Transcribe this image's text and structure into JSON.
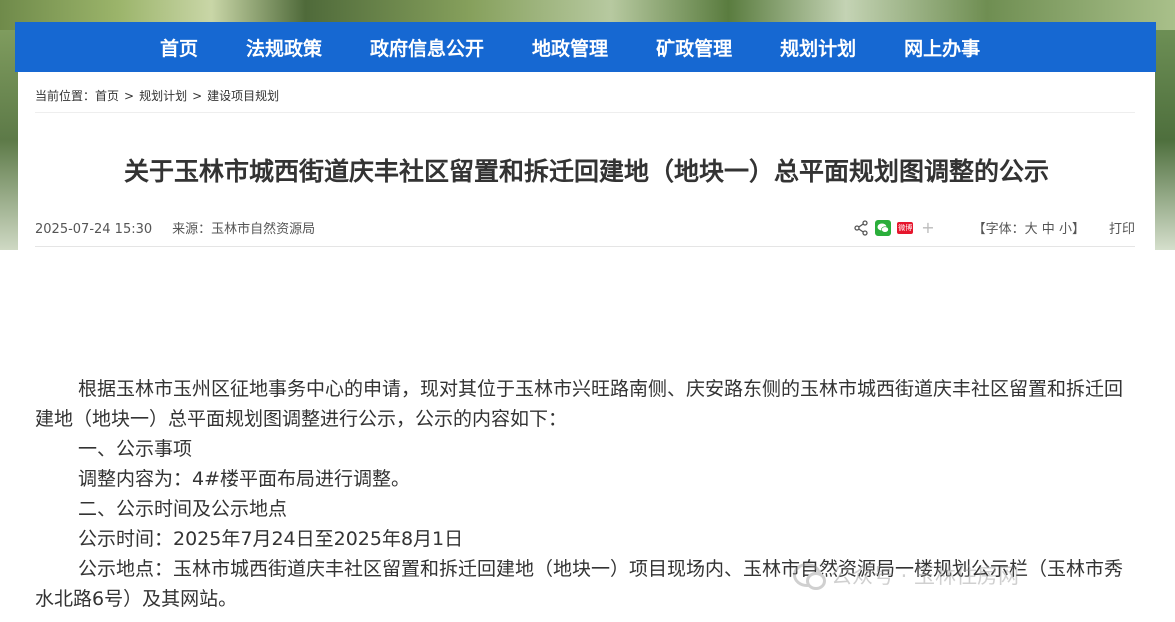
{
  "nav": {
    "items": [
      "首页",
      "法规政策",
      "政府信息公开",
      "地政管理",
      "矿政管理",
      "规划计划",
      "网上办事"
    ]
  },
  "breadcrumb": {
    "prefix": "当前位置：",
    "items": [
      "首页",
      "规划计划",
      "建设项目规划"
    ],
    "separator": ">"
  },
  "article": {
    "title": "关于玉林市城西街道庆丰社区留置和拆迁回建地（地块一）总平面规划图调整的公示",
    "datetime": "2025-07-24 15:30",
    "source": "来源：玉林市自然资源局",
    "paragraphs": [
      "根据玉林市玉州区征地事务中心的申请，现对其位于玉林市兴旺路南侧、庆安路东侧的玉林市城西街道庆丰社区留置和拆迁回建地（地块一）总平面规划图调整进行公示，公示的内容如下：",
      "一、公示事项",
      "调整内容为：4#楼平面布局进行调整。",
      "二、公示时间及公示地点",
      "公示时间：2025年7月24日至2025年8月1日",
      "公示地点：玉林市城西街道庆丰社区留置和拆迁回建地（地块一）项目现场内、玉林市自然资源局一楼规划公示栏（玉林市秀水北路6号）及其网站。"
    ]
  },
  "tools": {
    "font_prefix": "【字体：",
    "font_large": "大",
    "font_medium": "中",
    "font_small": "小",
    "font_suffix": "】",
    "print": "打印",
    "weibo_label": "微博",
    "icons": [
      "share-icon",
      "wechat-icon",
      "weibo-icon",
      "plus-icon"
    ]
  },
  "watermark": {
    "text": "公众号 · 玉林住房网"
  },
  "colors": {
    "nav_bg": "#1668d2",
    "wechat": "#2aae3a",
    "weibo": "#e6162d"
  }
}
